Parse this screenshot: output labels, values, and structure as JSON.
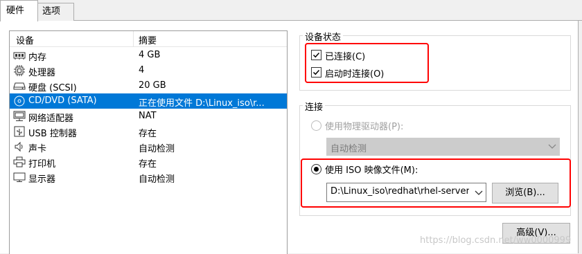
{
  "tabs": [
    {
      "label": "硬件",
      "active": true
    },
    {
      "label": "选项",
      "active": false
    }
  ],
  "device_list": {
    "header": {
      "device": "设备",
      "summary": "摘要"
    },
    "items": [
      {
        "icon": "memory-icon",
        "name": "内存",
        "summary": "4 GB"
      },
      {
        "icon": "processor-icon",
        "name": "处理器",
        "summary": "4"
      },
      {
        "icon": "harddisk-icon",
        "name": "硬盘 (SCSI)",
        "summary": "20 GB"
      },
      {
        "icon": "cd-dvd-icon",
        "name": "CD/DVD (SATA)",
        "summary": "正在使用文件 D:\\Linux_iso\\r...",
        "selected": true
      },
      {
        "icon": "network-adapter-icon",
        "name": "网络适配器",
        "summary": "NAT"
      },
      {
        "icon": "usb-icon",
        "name": "USB 控制器",
        "summary": "存在"
      },
      {
        "icon": "sound-card-icon",
        "name": "声卡",
        "summary": "自动检测"
      },
      {
        "icon": "printer-icon",
        "name": "打印机",
        "summary": "存在"
      },
      {
        "icon": "display-icon",
        "name": "显示器",
        "summary": "自动检测"
      }
    ]
  },
  "device_status": {
    "title": "设备状态",
    "connected": {
      "label": "已连接(C)",
      "checked": true
    },
    "connect_at_power_on": {
      "label": "启动时连接(O)",
      "checked": true
    }
  },
  "connection": {
    "title": "连接",
    "physical_drive": {
      "label": "使用物理驱动器(P):",
      "selected": false,
      "enabled": false
    },
    "physical_drive_value": "自动检测",
    "iso_image": {
      "label": "使用 ISO 映像文件(M):",
      "selected": true
    },
    "iso_path": "D:\\Linux_iso\\redhat\\rhel-server",
    "browse_label": "浏览(B)..."
  },
  "advanced_label": "高级(V)...",
  "watermark": "https://blog.csdn.net/ww0000999",
  "colors": {
    "selection": "#0078d7",
    "highlight": "#ff0000"
  }
}
